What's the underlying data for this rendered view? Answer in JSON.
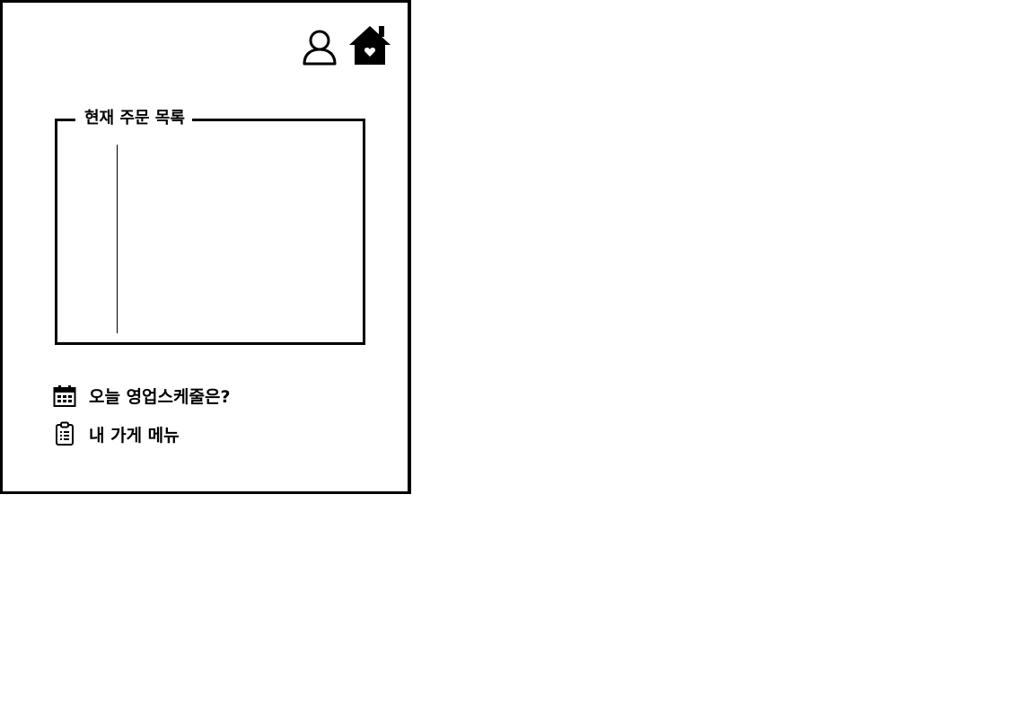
{
  "header": {
    "profile_icon": "person-outline-icon",
    "home_icon": "house-heart-icon"
  },
  "orders": {
    "title": "현재 주문 목록",
    "items": []
  },
  "menu": {
    "schedule": {
      "icon": "calendar-icon",
      "label": "오늘 영업스케줄은?"
    },
    "store_menu": {
      "icon": "clipboard-list-icon",
      "label": "내 가게 메뉴"
    }
  }
}
